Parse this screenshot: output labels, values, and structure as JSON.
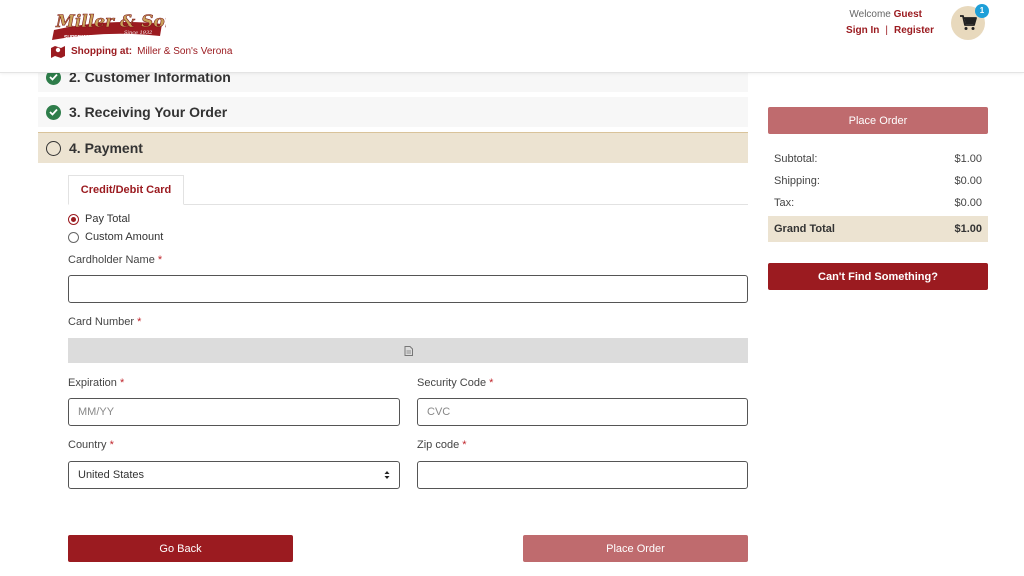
{
  "header": {
    "logo_text": "Miller & Sons",
    "logo_sub": "SUPERMARKET",
    "logo_since": "Since 1932",
    "shopping_at_label": "Shopping at:",
    "shopping_at_store": "Miller & Son's Verona",
    "welcome_text": "Welcome",
    "welcome_user": "Guest",
    "sign_in": "Sign In",
    "separator": "|",
    "register": "Register",
    "cart_count": "1"
  },
  "steps": [
    {
      "number_label": "2. Customer Information",
      "status": "complete"
    },
    {
      "number_label": "3. Receiving Your Order",
      "status": "complete"
    },
    {
      "number_label": "4. Payment",
      "status": "active"
    }
  ],
  "payment": {
    "tab_label": "Credit/Debit Card",
    "radio_options": [
      {
        "label": "Pay Total",
        "selected": true
      },
      {
        "label": "Custom Amount",
        "selected": false
      }
    ],
    "cardholder_label": "Cardholder Name",
    "cardholder_value": "",
    "card_number_label": "Card Number",
    "expiration_label": "Expiration",
    "expiration_placeholder": "MM/YY",
    "security_label": "Security Code",
    "security_placeholder": "CVC",
    "country_label": "Country",
    "country_value": "United States",
    "zip_label": "Zip code",
    "zip_value": "",
    "required_mark": "*",
    "go_back": "Go Back",
    "place_order": "Place Order"
  },
  "summary": {
    "place_order": "Place Order",
    "rows": [
      {
        "label": "Subtotal:",
        "value": "$1.00"
      },
      {
        "label": "Shipping:",
        "value": "$0.00"
      },
      {
        "label": "Tax:",
        "value": "$0.00"
      }
    ],
    "grand_total_label": "Grand Total",
    "grand_total_value": "$1.00",
    "cant_find": "Can't Find Something?"
  },
  "colors": {
    "brand": "#9b1b20",
    "brand_light": "#bf6b6e",
    "active_step": "#ece3d1",
    "check": "#2e7d4a",
    "cart_badge": "#1e9fd8"
  }
}
